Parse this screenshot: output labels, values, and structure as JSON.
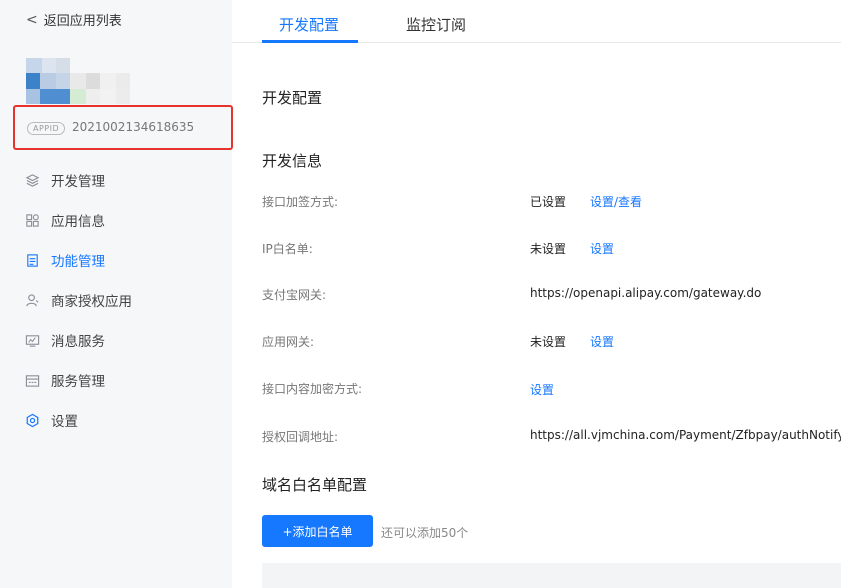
{
  "sidebar": {
    "back_label": "返回应用列表",
    "appid_tag": "APPID",
    "appid_value": "2021002134618635",
    "highlight_color": "#e8322d",
    "items": [
      {
        "label": "开发管理",
        "icon": "layers-icon"
      },
      {
        "label": "应用信息",
        "icon": "grid-icon"
      },
      {
        "label": "功能管理",
        "icon": "document-icon"
      },
      {
        "label": "商家授权应用",
        "icon": "user-icon"
      },
      {
        "label": "消息服务",
        "icon": "monitor-icon"
      },
      {
        "label": "服务管理",
        "icon": "calendar-icon"
      },
      {
        "label": "设置",
        "icon": "gear-icon"
      }
    ],
    "active_item": "功能管理"
  },
  "tabs": [
    {
      "label": "开发配置",
      "active": true
    },
    {
      "label": "监控订阅",
      "active": false
    }
  ],
  "accent_color": "#1677ff",
  "main": {
    "section_title": "开发配置",
    "dev_info_title": "开发信息",
    "rows": [
      {
        "label": "接口加签方式:",
        "value": "已设置",
        "link": "设置/查看"
      },
      {
        "label": "IP白名单:",
        "value": "未设置",
        "link": "设置"
      },
      {
        "label": "支付宝网关:",
        "value": "https://openapi.alipay.com/gateway.do",
        "link": ""
      },
      {
        "label": "应用网关:",
        "value": "未设置",
        "link": "设置"
      },
      {
        "label": "接口内容加密方式:",
        "value": "",
        "link": "设置"
      },
      {
        "label": "授权回调地址:",
        "value": "https://all.vjmchina.com/Payment/Zfbpay/authNotify.h",
        "link": ""
      }
    ],
    "domain_title": "域名白名单配置",
    "add_button": "+添加白名单",
    "add_hint": "还可以添加50个"
  }
}
